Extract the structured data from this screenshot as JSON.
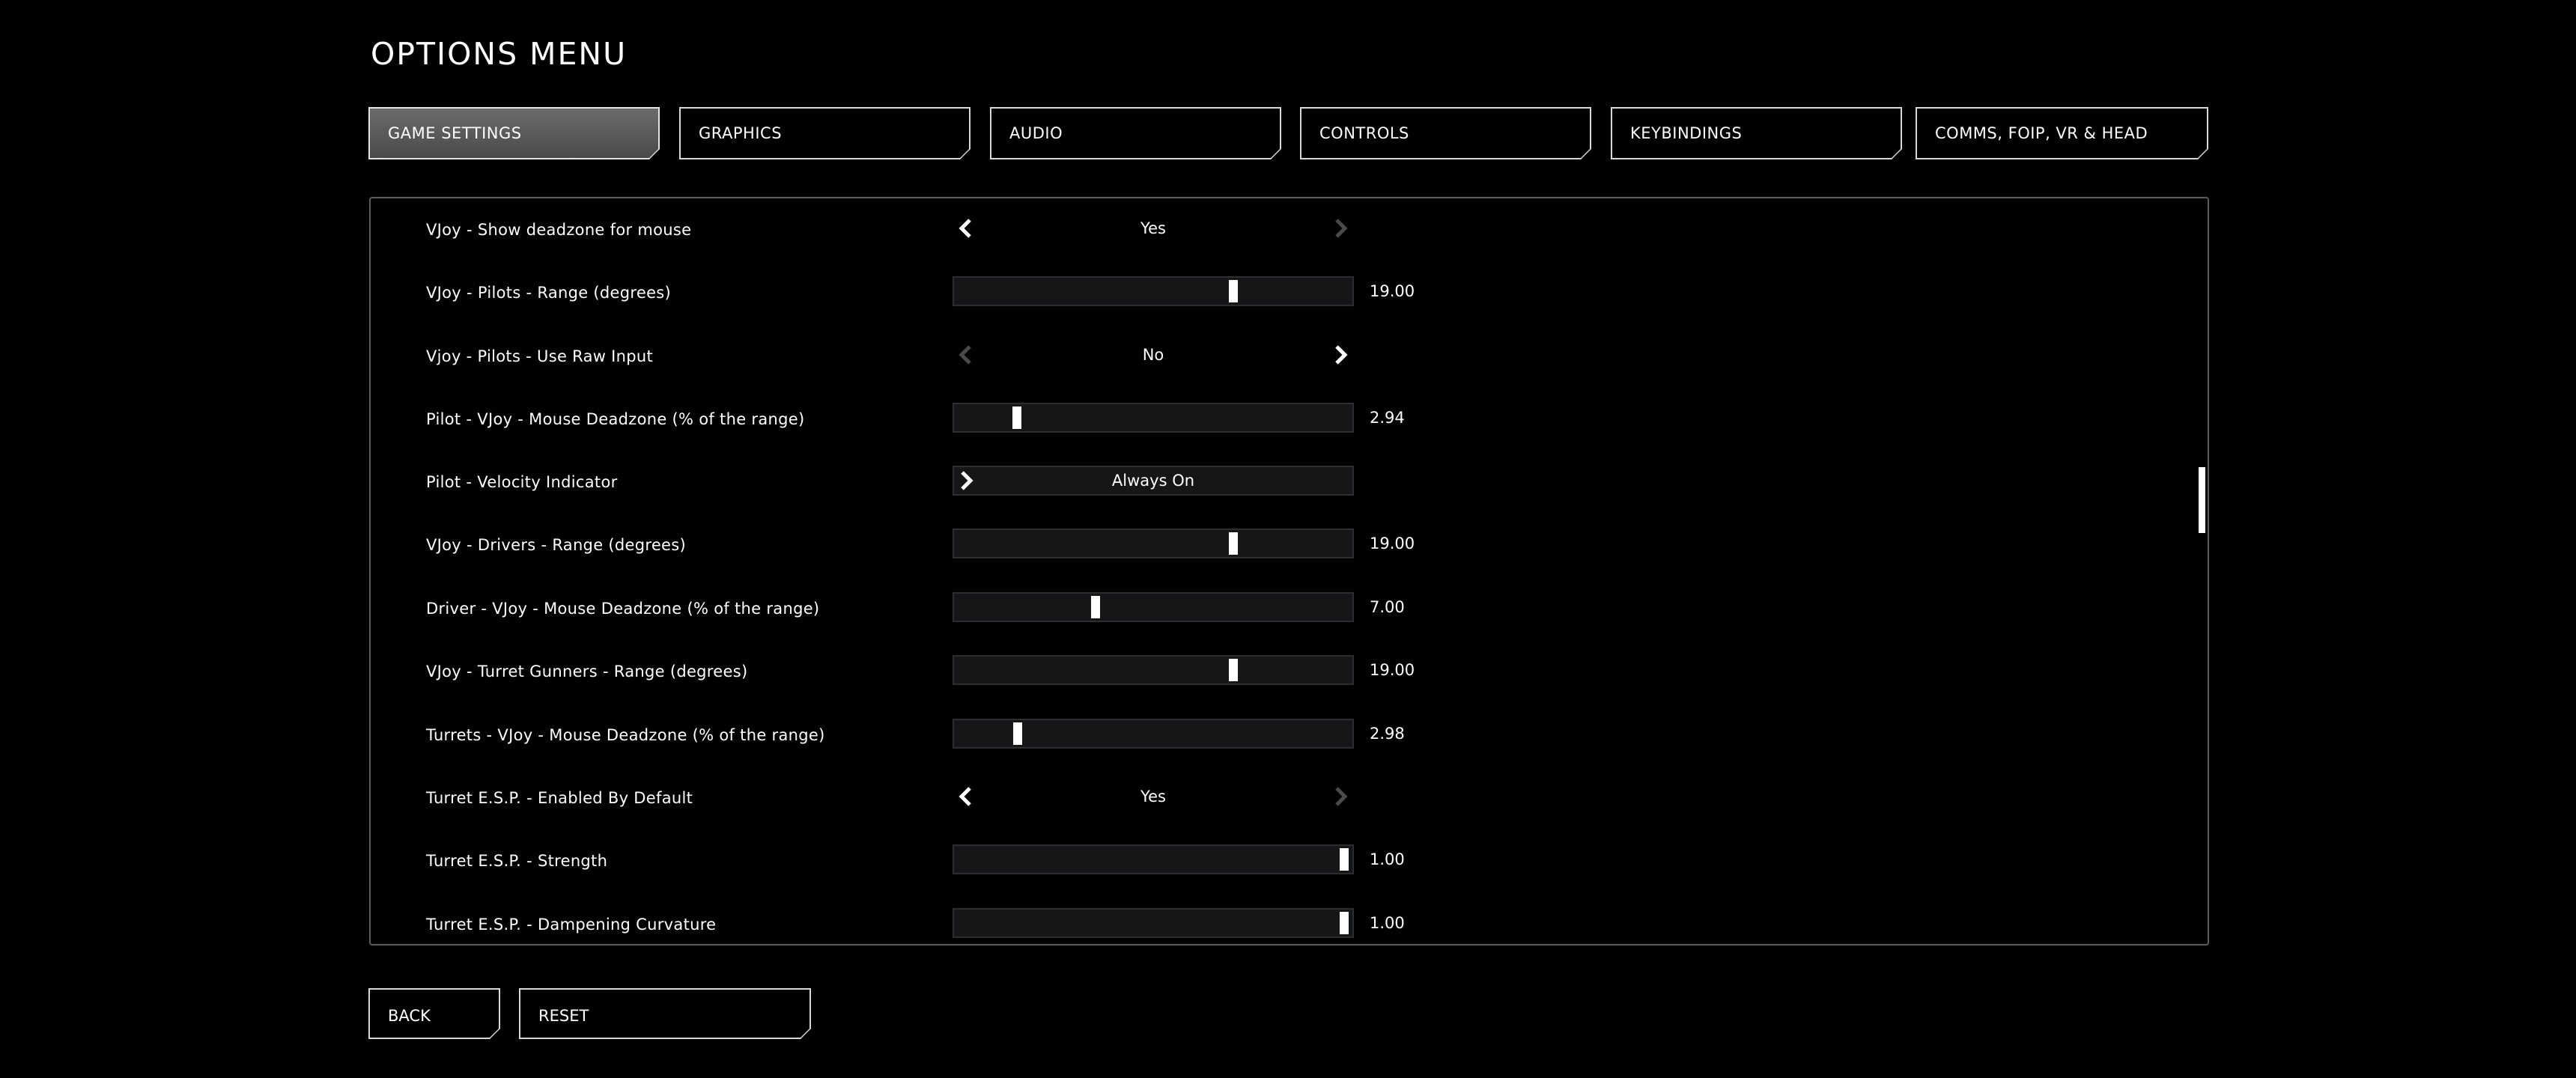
{
  "title": "OPTIONS MENU",
  "tabs": [
    {
      "label": "GAME SETTINGS",
      "active": true
    },
    {
      "label": "GRAPHICS",
      "active": false
    },
    {
      "label": "AUDIO",
      "active": false
    },
    {
      "label": "CONTROLS",
      "active": false
    },
    {
      "label": "KEYBINDINGS",
      "active": false
    },
    {
      "label": "COMMS, FOIP, VR & HEAD TRACKING",
      "active": false
    }
  ],
  "settings": [
    {
      "label": "VJoy - Show deadzone for mouse",
      "type": "selector",
      "value": "Yes",
      "left_enabled": true,
      "right_enabled": false
    },
    {
      "label": "VJoy - Pilots - Range (degrees)",
      "type": "slider",
      "value": "19.00",
      "level": 0.72
    },
    {
      "label": "Vjoy - Pilots - Use Raw Input",
      "type": "selector",
      "value": "No",
      "left_enabled": false,
      "right_enabled": true
    },
    {
      "label": "Pilot - VJoy - Mouse Deadzone (% of the range)",
      "type": "slider",
      "value": "2.94",
      "level": 0.15
    },
    {
      "label": "Pilot - Velocity Indicator",
      "type": "dropdown",
      "value": "Always On"
    },
    {
      "label": "VJoy - Drivers - Range (degrees)",
      "type": "slider",
      "value": "19.00",
      "level": 0.72
    },
    {
      "label": "Driver - VJoy - Mouse Deadzone (% of the range)",
      "type": "slider",
      "value": "7.00",
      "level": 0.35
    },
    {
      "label": "VJoy - Turret Gunners - Range (degrees)",
      "type": "slider",
      "value": "19.00",
      "level": 0.72
    },
    {
      "label": "Turrets - VJoy - Mouse Deadzone (% of the range)",
      "type": "slider",
      "value": "2.98",
      "level": 0.15
    },
    {
      "label": "Turret E.S.P. - Enabled By Default",
      "type": "selector",
      "value": "Yes",
      "left_enabled": true,
      "right_enabled": false
    },
    {
      "label": "Turret E.S.P. - Strength",
      "type": "slider",
      "value": "1.00",
      "level": 1.0
    },
    {
      "label": "Turret E.S.P. - Dampening Curvature",
      "type": "slider",
      "value": "1.00",
      "level": 1.0
    }
  ],
  "buttons": {
    "back": "BACK",
    "reset": "RESET"
  },
  "colors": {
    "background": "#000000",
    "text": "#ffffff",
    "track": "#141617",
    "arrow_disabled": "#4a4a4a"
  }
}
